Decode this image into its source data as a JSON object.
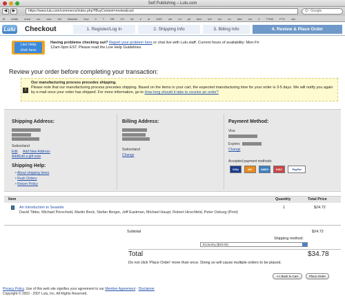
{
  "window": {
    "title": "Self Publishing – Lulu.com"
  },
  "toolbar": {
    "back": "◀",
    "forward": "▶",
    "url": "https://www.lulu.com/commerce/index.php?fBuyContent=review&cart",
    "search_placeholder": "Q~ Google"
  },
  "bookmarks": [
    "flt",
    "xrfdth",
    "orkut",
    "ms",
    "cwn",
    "ehi",
    "Wavehk",
    "Oca",
    "0",
    "T",
    "EB",
    "CC",
    "blr",
    "e",
    "ut",
    "GAS",
    "cbr",
    "ml",
    "ytt",
    "dvm",
    "kef",
    "mo",
    "eu",
    "lcks",
    "mo",
    "0",
    "TTM3",
    "FTG",
    "ckn"
  ],
  "header": {
    "logo": "Lulu",
    "title": "Checkout",
    "steps": [
      "1. Register/Log In",
      "2. Shipping Info",
      "3. Billing Info",
      "4. Review & Place Order"
    ]
  },
  "help": {
    "badge_title": "Live Help",
    "badge_sub": "click here",
    "lead": "Having problems checking out?",
    "report_link": "Report your problem here",
    "mid": "or chat live with Lulu staff. Current hours of availability: Mon-Fri",
    "line2": "12am-9pm EST. Please read the Live Help Guidelines"
  },
  "review_heading": "Review your order before completing your transaction:",
  "notice": {
    "title": "Our manufacturing process precedes shipping.",
    "body": "Please note that our manufacturing process precedes shipping. Based on the items in your cart, the expected manufacturing time for your order is 3-5 days. We will notify you again by e-mail once your order has shipped. For more information, go to",
    "link": "How long should it take to receive an order?"
  },
  "shipping": {
    "title": "Shipping Address:",
    "country": "Switzerland",
    "edit": "Edit",
    "add_new": "Add New Address",
    "gift": "Add/Edit a gift note",
    "help_title": "Shipping Help:",
    "help_links": [
      "About shipping times",
      "Rush Orders",
      "Return Policy"
    ]
  },
  "billing": {
    "title": "Billing Address:",
    "country": "Switzerland",
    "change": "Change"
  },
  "payment": {
    "title": "Payment Method:",
    "card": "Visa",
    "expires": "Expires",
    "change": "Change",
    "accepted": "Accepted payment methods:",
    "cards": [
      "VISA",
      "MC",
      "AMEX",
      "DISC",
      "PayPal"
    ]
  },
  "items": {
    "headers": {
      "item": "Item",
      "quantity": "Quantity",
      "total": "Total Price"
    },
    "rows": [
      {
        "title": "An Introduction to Seaside",
        "authors": "David Tibbe, Michael Perscheid, Martin Beck, Stefan Berger, Jeff Eastman, Michael Haupt, Robert Hirschfeld, Peter Osburg (Print)",
        "qty": "1",
        "price": "$24.72"
      }
    ]
  },
  "totals": {
    "subtotal_label": "Subtotal",
    "subtotal": "$24.72",
    "shipping_label": "Shipping method:",
    "shipping_option": "Economy ($10.04)",
    "total_label": "Total",
    "total": "$34.78",
    "warning": "Do not click 'Place Order' more than once. Doing so will cause multiple orders to be placed."
  },
  "buttons": {
    "back": "<< Back to Cart",
    "place": "Place Order"
  },
  "footer": {
    "privacy": "Privacy Policy",
    "mid": ". Use of this web site signifies your agreement to our",
    "terms": "Member Agreement",
    "disclaimer": "Disclaimer",
    "copyright": "Copyright © 2002 - 2007 Lulu, Inc. All Rights Reserved."
  }
}
